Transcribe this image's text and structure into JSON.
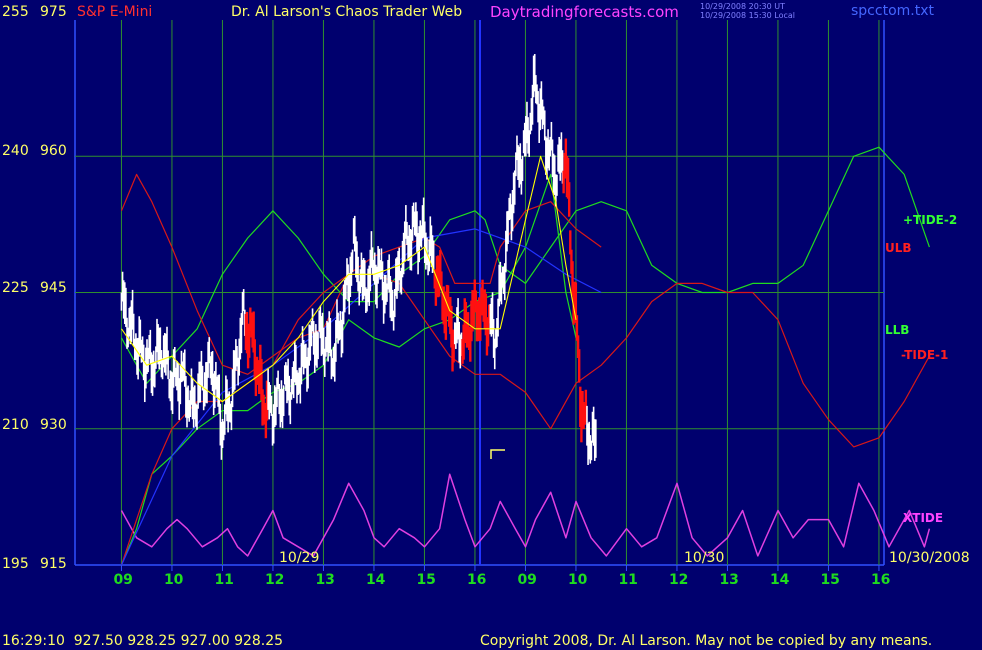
{
  "header": {
    "left_scale_top": "255",
    "price_top": "975",
    "instrument": "S&P E-Mini",
    "title": "Dr. Al Larson's Chaos Trader Web",
    "site": "Daytradingforecasts.com",
    "time_ut": "10/29/2008 20:30 UT",
    "time_local": "10/29/2008 15:30 Local",
    "file": "spcctom.txt"
  },
  "footer": {
    "quote": "16:29:10  927.50 928.25 927.00 928.25",
    "copyright": "Copyright 2008, Dr. Al Larson. May not be copied by any means."
  },
  "colors": {
    "background": "#00006e",
    "grid": "#2f8f2f",
    "price": "#ffffff",
    "down_price": "#ff1010",
    "green_line": "#1fdc1f",
    "red_line": "#d81818",
    "blue_line": "#2233ff",
    "yellow_line": "#ffff00",
    "xtide": "#e040e0",
    "axis_text": "#ffff66"
  },
  "chart_data": {
    "type": "line",
    "y_left_ticks": [
      "255",
      "240",
      "225",
      "210",
      "195"
    ],
    "y_right_ticks": [
      "975",
      "960",
      "945",
      "930",
      "915"
    ],
    "ylim": [
      915,
      975
    ],
    "x_hour_labels": [
      "09",
      "10",
      "11",
      "12",
      "13",
      "14",
      "15",
      "16",
      "09",
      "10",
      "11",
      "12",
      "13",
      "14",
      "15",
      "16"
    ],
    "date_labels": [
      "10/29",
      "10/30",
      "10/30/2008"
    ],
    "series_labels": [
      "+TIDE-2",
      "ULB",
      "LLB",
      "-TIDE-1",
      "XTIDE"
    ],
    "price_close": [
      [
        0.0,
        944
      ],
      [
        0.2,
        941
      ],
      [
        0.4,
        938
      ],
      [
        0.6,
        937
      ],
      [
        0.8,
        939
      ],
      [
        1.0,
        935
      ],
      [
        1.2,
        936
      ],
      [
        1.4,
        932
      ],
      [
        1.6,
        935
      ],
      [
        1.8,
        937
      ],
      [
        2.0,
        930
      ],
      [
        2.2,
        934
      ],
      [
        2.4,
        942
      ],
      [
        2.6,
        940
      ],
      [
        2.8,
        933
      ],
      [
        3.0,
        932
      ],
      [
        3.2,
        934
      ],
      [
        3.4,
        935
      ],
      [
        3.6,
        937
      ],
      [
        3.8,
        940
      ],
      [
        4.0,
        940
      ],
      [
        4.2,
        938
      ],
      [
        4.4,
        943
      ],
      [
        4.6,
        950
      ],
      [
        4.8,
        945
      ],
      [
        5.0,
        948
      ],
      [
        5.2,
        946
      ],
      [
        5.4,
        944
      ],
      [
        5.6,
        950
      ],
      [
        5.8,
        952
      ],
      [
        6.0,
        951
      ],
      [
        6.2,
        948
      ],
      [
        6.4,
        944
      ],
      [
        6.6,
        940
      ],
      [
        6.8,
        940
      ],
      [
        7.0,
        943
      ],
      [
        7.2,
        943
      ],
      [
        7.4,
        940
      ],
      [
        7.6,
        949
      ],
      [
        7.8,
        958
      ],
      [
        8.0,
        961
      ],
      [
        8.2,
        968
      ],
      [
        8.4,
        962
      ],
      [
        8.6,
        958
      ],
      [
        8.8,
        960
      ],
      [
        8.9,
        950
      ],
      [
        9.0,
        942
      ],
      [
        9.1,
        933
      ],
      [
        9.2,
        930
      ],
      [
        9.3,
        929
      ],
      [
        9.4,
        928
      ]
    ],
    "red_segments": [
      [
        2.45,
        2.9
      ],
      [
        6.2,
        6.6
      ],
      [
        6.75,
        7.3
      ],
      [
        8.75,
        9.2
      ]
    ],
    "green_upper": [
      [
        0.0,
        940
      ],
      [
        0.5,
        935
      ],
      [
        1.0,
        938
      ],
      [
        1.5,
        941
      ],
      [
        2.0,
        947
      ],
      [
        2.5,
        951
      ],
      [
        3.0,
        954
      ],
      [
        3.5,
        951
      ],
      [
        4.0,
        947
      ],
      [
        4.5,
        944
      ],
      [
        5.0,
        944
      ],
      [
        5.5,
        947
      ],
      [
        6.0,
        949
      ],
      [
        6.5,
        953
      ],
      [
        7.0,
        954
      ],
      [
        7.2,
        953
      ],
      [
        7.5,
        948
      ],
      [
        8.0,
        946
      ],
      [
        8.5,
        950
      ],
      [
        9.0,
        954
      ],
      [
        9.5,
        955
      ],
      [
        10.0,
        954
      ],
      [
        10.5,
        948
      ],
      [
        11.0,
        946
      ],
      [
        11.5,
        945
      ],
      [
        12.0,
        945
      ],
      [
        12.5,
        946
      ],
      [
        13.0,
        946
      ],
      [
        13.5,
        948
      ],
      [
        14.0,
        954
      ],
      [
        14.5,
        960
      ],
      [
        15.0,
        961
      ],
      [
        15.5,
        958
      ],
      [
        16.0,
        950
      ]
    ],
    "green_lower": [
      [
        0.0,
        915
      ],
      [
        0.3,
        919
      ],
      [
        0.6,
        925
      ],
      [
        1.0,
        927
      ],
      [
        1.5,
        930
      ],
      [
        2.0,
        932
      ],
      [
        2.5,
        932
      ],
      [
        3.0,
        934
      ],
      [
        3.5,
        935
      ],
      [
        4.0,
        937
      ],
      [
        4.5,
        942
      ],
      [
        5.0,
        940
      ],
      [
        5.5,
        939
      ],
      [
        6.0,
        941
      ],
      [
        6.5,
        942
      ],
      [
        7.0,
        944
      ],
      [
        7.5,
        945
      ],
      [
        8.0,
        950
      ],
      [
        8.5,
        958
      ],
      [
        8.8,
        945
      ],
      [
        9.0,
        940
      ]
    ],
    "red_upper": [
      [
        0.0,
        954
      ],
      [
        0.3,
        958
      ],
      [
        0.6,
        955
      ],
      [
        1.0,
        950
      ],
      [
        1.5,
        943
      ],
      [
        2.0,
        937
      ],
      [
        2.5,
        936
      ],
      [
        3.0,
        938
      ],
      [
        3.5,
        940
      ],
      [
        4.0,
        941
      ],
      [
        4.5,
        947
      ],
      [
        5.0,
        949
      ],
      [
        5.5,
        950
      ],
      [
        6.0,
        951
      ],
      [
        6.3,
        950
      ],
      [
        6.6,
        946
      ],
      [
        7.0,
        946
      ],
      [
        7.3,
        946
      ],
      [
        7.5,
        950
      ],
      [
        8.0,
        954
      ],
      [
        8.5,
        955
      ],
      [
        9.0,
        952
      ],
      [
        9.5,
        950
      ]
    ],
    "red_lower": [
      [
        0.0,
        915
      ],
      [
        0.3,
        920
      ],
      [
        0.6,
        925
      ],
      [
        1.0,
        930
      ],
      [
        1.5,
        933
      ],
      [
        2.0,
        933
      ],
      [
        2.5,
        935
      ],
      [
        3.0,
        937
      ],
      [
        3.5,
        942
      ],
      [
        4.0,
        945
      ],
      [
        4.5,
        947
      ],
      [
        5.0,
        947
      ],
      [
        5.5,
        946
      ],
      [
        6.0,
        942
      ],
      [
        6.5,
        938
      ],
      [
        7.0,
        936
      ],
      [
        7.5,
        936
      ],
      [
        8.0,
        934
      ],
      [
        8.5,
        930
      ],
      [
        9.0,
        935
      ],
      [
        9.5,
        937
      ],
      [
        10.0,
        940
      ],
      [
        10.5,
        944
      ],
      [
        11.0,
        946
      ],
      [
        11.5,
        946
      ],
      [
        12.0,
        945
      ],
      [
        12.5,
        945
      ],
      [
        13.0,
        942
      ],
      [
        13.5,
        935
      ],
      [
        14.0,
        931
      ],
      [
        14.5,
        928
      ],
      [
        15.0,
        929
      ],
      [
        15.5,
        933
      ],
      [
        16.0,
        938
      ]
    ],
    "blue_line": [
      [
        0.0,
        915
      ],
      [
        1.0,
        927
      ],
      [
        2.0,
        934
      ],
      [
        3.0,
        937
      ],
      [
        4.0,
        941
      ],
      [
        5.0,
        946
      ],
      [
        6.0,
        951
      ],
      [
        7.0,
        952
      ],
      [
        8.0,
        950
      ],
      [
        8.8,
        947
      ],
      [
        9.5,
        945
      ]
    ],
    "yellow_line": [
      [
        0.0,
        941
      ],
      [
        0.5,
        937
      ],
      [
        1.0,
        938
      ],
      [
        1.5,
        935
      ],
      [
        2.0,
        933
      ],
      [
        2.5,
        935
      ],
      [
        3.0,
        937
      ],
      [
        3.5,
        940
      ],
      [
        4.0,
        944
      ],
      [
        4.5,
        947
      ],
      [
        5.0,
        947
      ],
      [
        5.5,
        948
      ],
      [
        6.0,
        950
      ],
      [
        6.5,
        943
      ],
      [
        7.0,
        941
      ],
      [
        7.5,
        941
      ],
      [
        8.0,
        953
      ],
      [
        8.3,
        960
      ],
      [
        8.6,
        955
      ],
      [
        8.8,
        948
      ],
      [
        9.0,
        942
      ]
    ],
    "xtide": [
      [
        0.0,
        921
      ],
      [
        0.3,
        918
      ],
      [
        0.6,
        917
      ],
      [
        0.9,
        919
      ],
      [
        1.1,
        920
      ],
      [
        1.3,
        919
      ],
      [
        1.6,
        917
      ],
      [
        1.9,
        918
      ],
      [
        2.1,
        919
      ],
      [
        2.3,
        917
      ],
      [
        2.5,
        916
      ],
      [
        2.8,
        919
      ],
      [
        3.0,
        921
      ],
      [
        3.2,
        918
      ],
      [
        3.5,
        917
      ],
      [
        3.8,
        916
      ],
      [
        4.0,
        918
      ],
      [
        4.2,
        920
      ],
      [
        4.5,
        924
      ],
      [
        4.8,
        921
      ],
      [
        5.0,
        918
      ],
      [
        5.2,
        917
      ],
      [
        5.5,
        919
      ],
      [
        5.8,
        918
      ],
      [
        6.0,
        917
      ],
      [
        6.3,
        919
      ],
      [
        6.5,
        925
      ],
      [
        6.8,
        920
      ],
      [
        7.0,
        917
      ],
      [
        7.3,
        919
      ],
      [
        7.5,
        922
      ],
      [
        7.8,
        919
      ],
      [
        8.0,
        917
      ],
      [
        8.2,
        920
      ],
      [
        8.5,
        923
      ],
      [
        8.8,
        918
      ],
      [
        9.0,
        922
      ],
      [
        9.3,
        918
      ],
      [
        9.6,
        916
      ],
      [
        10.0,
        919
      ],
      [
        10.3,
        917
      ],
      [
        10.6,
        918
      ],
      [
        11.0,
        924
      ],
      [
        11.3,
        918
      ],
      [
        11.6,
        916
      ],
      [
        12.0,
        918
      ],
      [
        12.3,
        921
      ],
      [
        12.6,
        916
      ],
      [
        13.0,
        921
      ],
      [
        13.3,
        918
      ],
      [
        13.6,
        920
      ],
      [
        14.0,
        920
      ],
      [
        14.3,
        917
      ],
      [
        14.6,
        924
      ],
      [
        14.9,
        921
      ],
      [
        15.2,
        917
      ],
      [
        15.6,
        921
      ],
      [
        15.9,
        917
      ],
      [
        16.0,
        919
      ]
    ]
  }
}
